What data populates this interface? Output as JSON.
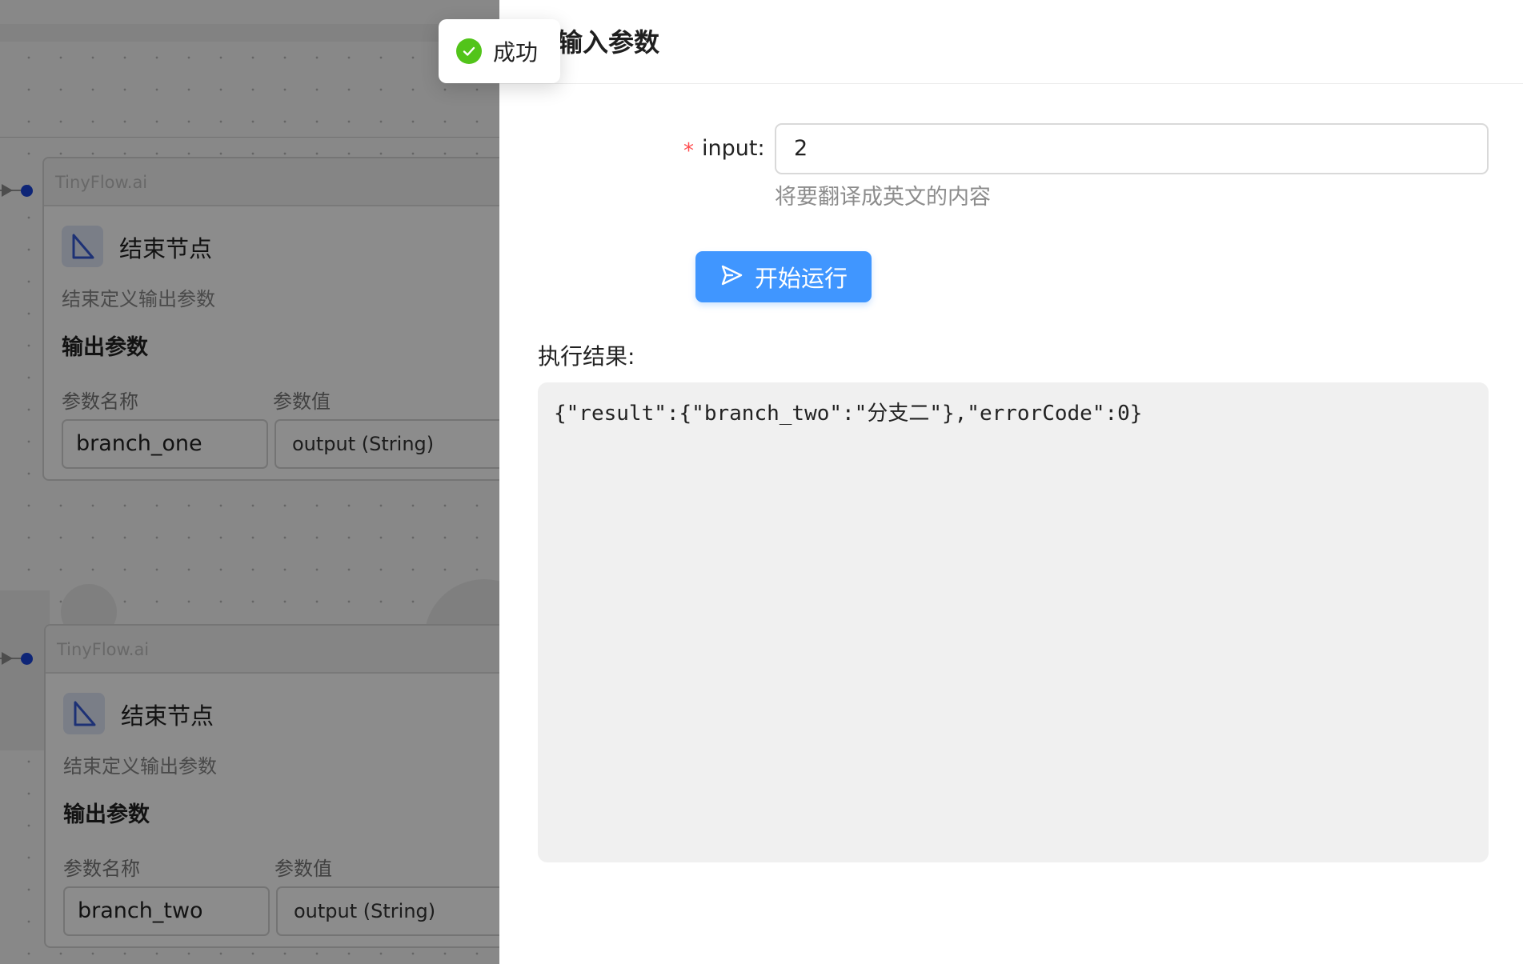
{
  "canvas": {
    "nodes": [
      {
        "header": "TinyFlow.ai",
        "title": "结束节点",
        "description": "结束定义输出参数",
        "section_title": "输出参数",
        "col_name": "参数名称",
        "col_value": "参数值",
        "param_name": "branch_one",
        "param_value": "output (String)"
      },
      {
        "header": "TinyFlow.ai",
        "title": "结束节点",
        "description": "结束定义输出参数",
        "section_title": "输出参数",
        "col_name": "参数名称",
        "col_value": "参数值",
        "param_name": "branch_two",
        "param_value": "output (String)"
      }
    ]
  },
  "toast": {
    "icon": "check-circle-icon",
    "text": "成功",
    "color": "#52c41a"
  },
  "drawer": {
    "title": "输入参数",
    "field": {
      "required_mark": "*",
      "label": "input:",
      "value": "2",
      "help": "将要翻译成英文的内容"
    },
    "run_button": {
      "icon": "send-icon",
      "label": "开始运行",
      "color": "#4096ff"
    },
    "result": {
      "label": "执行结果:",
      "text": "{\"result\":{\"branch_two\":\"分支二\"},\"errorCode\":0}"
    }
  }
}
